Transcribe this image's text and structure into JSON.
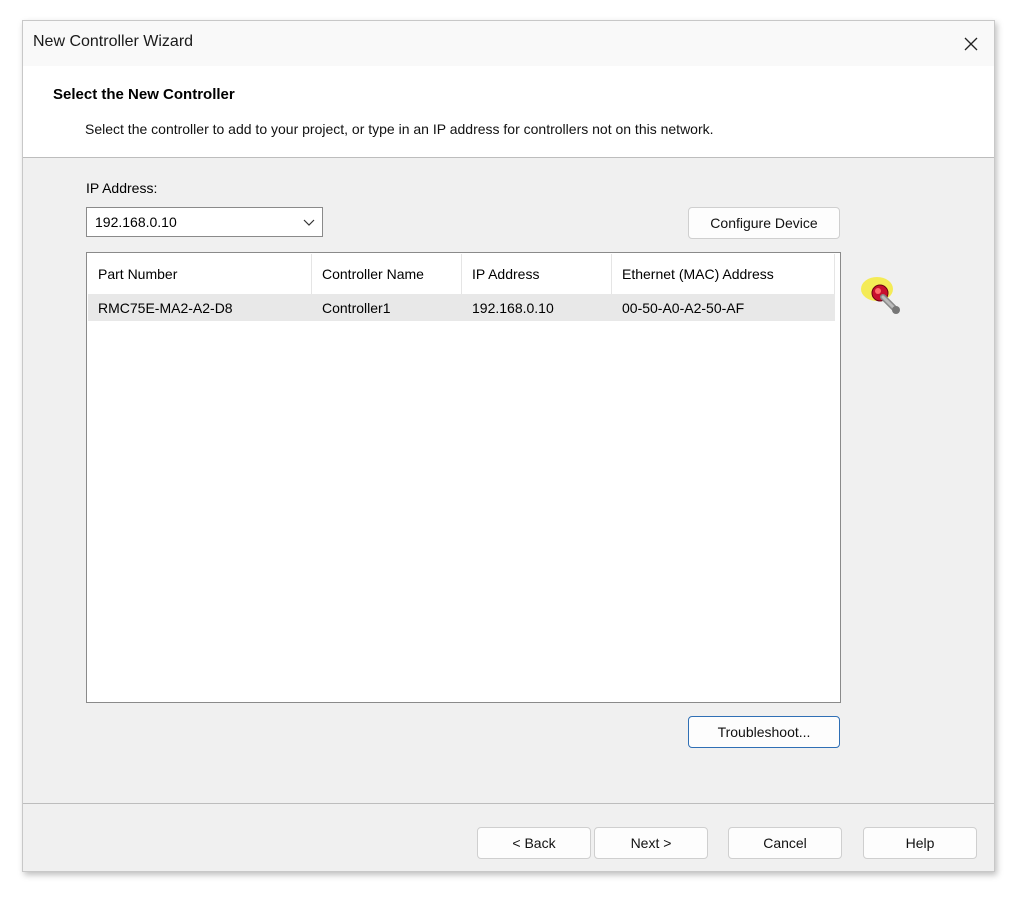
{
  "window": {
    "title": "New Controller Wizard",
    "close_glyph": "✕"
  },
  "header": {
    "title": "Select the New Controller",
    "description": "Select the controller to add to your project, or type in an IP address for controllers not on this network."
  },
  "ip_field": {
    "label": "IP Address:",
    "value": "192.168.0.10"
  },
  "buttons": {
    "configure_device": "Configure Device",
    "troubleshoot": "Troubleshoot...",
    "back": "< Back",
    "next": "Next >",
    "cancel": "Cancel",
    "help": "Help"
  },
  "table": {
    "columns": [
      "Part Number",
      "Controller Name",
      "IP Address",
      "Ethernet (MAC) Address"
    ],
    "rows": [
      [
        "RMC75E-MA2-A2-D8",
        "Controller1",
        "192.168.0.10",
        "00-50-A0-A2-50-AF"
      ]
    ]
  },
  "icons": {
    "close": "close-icon",
    "dropdown": "chevron-down-icon",
    "status": "connection-status-icon"
  },
  "colors": {
    "window_bg": "#f0f0f0",
    "panel_bg": "#ffffff",
    "selected_row": "#e8e8e8",
    "focus_border": "#2f6fb5",
    "status_glow": "#f5ea3b",
    "status_red": "#c8102e"
  }
}
